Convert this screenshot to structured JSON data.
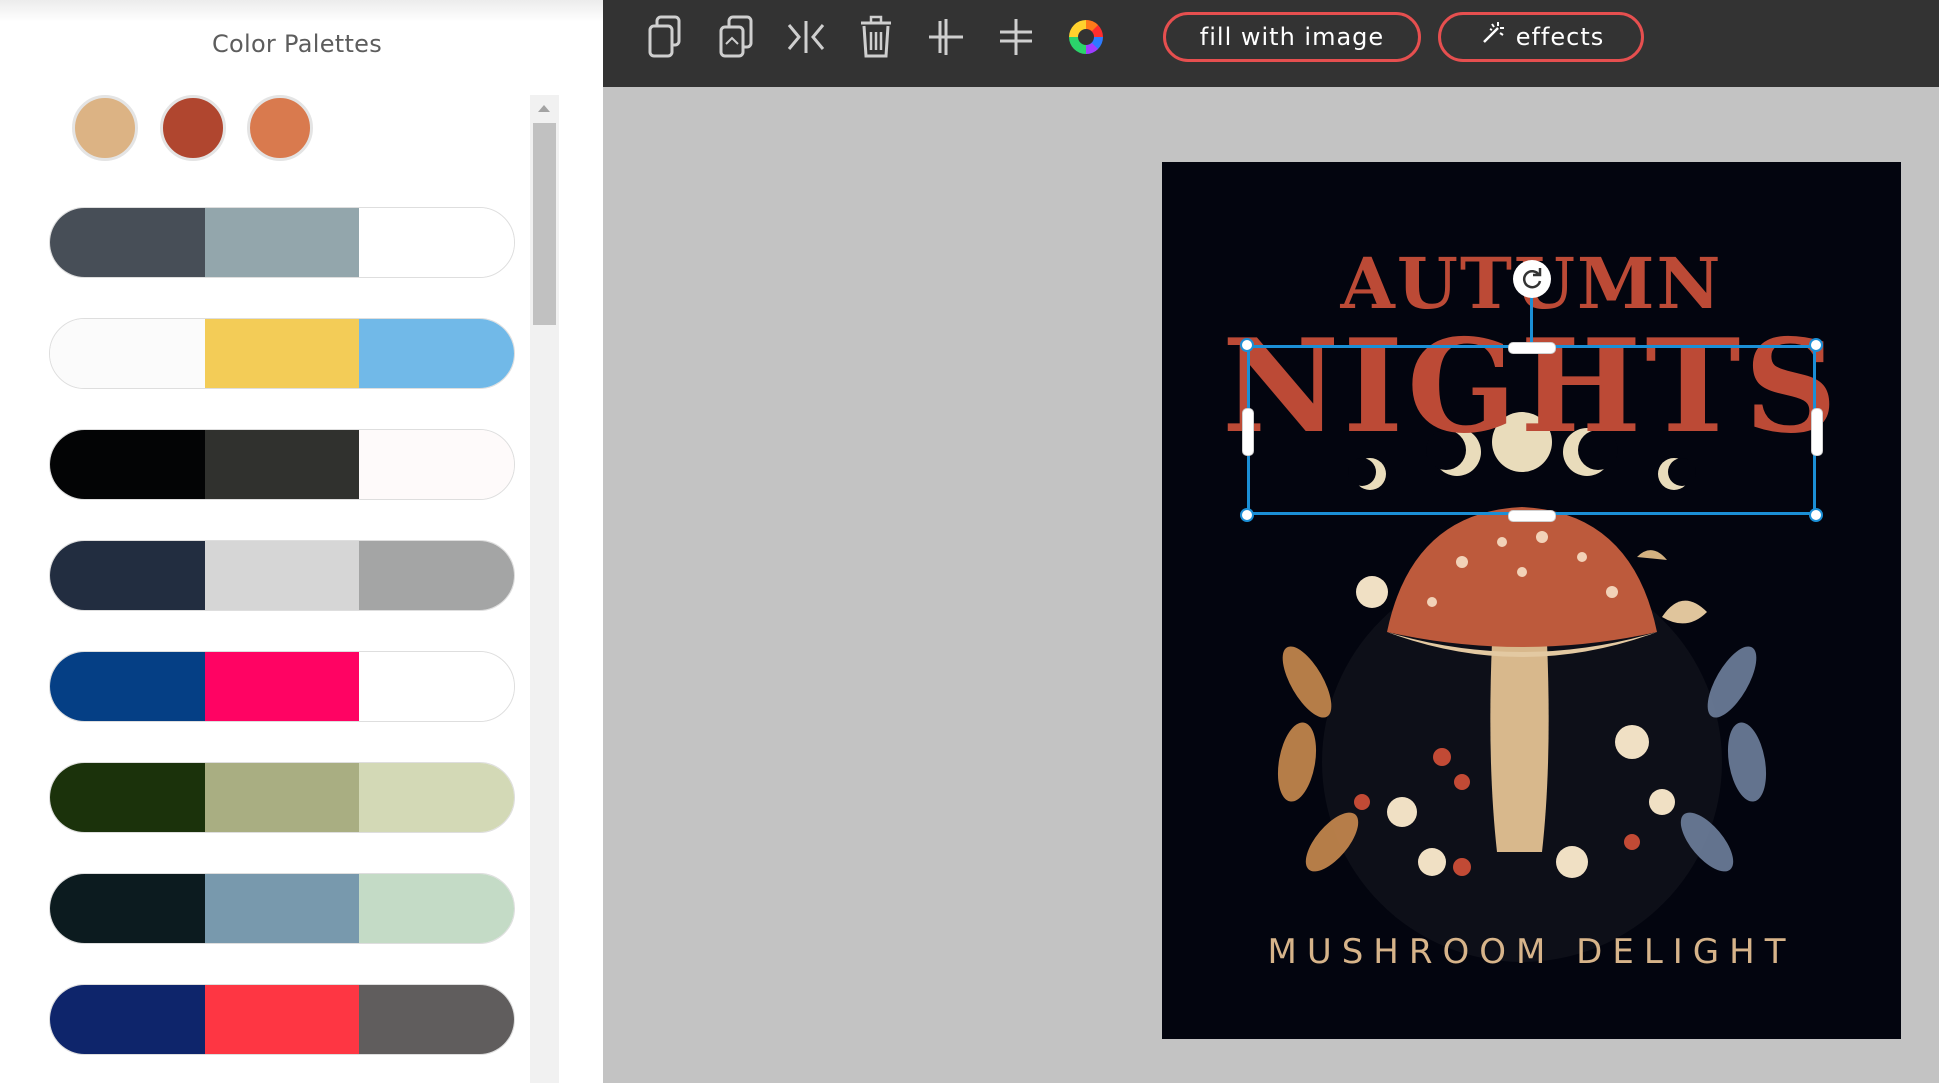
{
  "sidebar": {
    "title": "Color Palettes",
    "swatches": [
      {
        "color": "#dcb384"
      },
      {
        "color": "#b0462f"
      },
      {
        "color": "#d97a4e"
      }
    ],
    "palettes": [
      [
        "#474e57",
        "#93a6ac",
        "#ffffff"
      ],
      [
        "#fbfbfb",
        "#f3cc57",
        "#71b9e8"
      ],
      [
        "#030405",
        "#30312e",
        "#fefafa"
      ],
      [
        "#222d40",
        "#d6d6d6",
        "#a4a5a5"
      ],
      [
        "#053f85",
        "#ff0363",
        "#ffffff"
      ],
      [
        "#1b320b",
        "#a9ae82",
        "#d3d9b6"
      ],
      [
        "#0c1b1f",
        "#7899ad",
        "#c4dbc6"
      ],
      [
        "#0e256b",
        "#fe3643",
        "#605d5d"
      ]
    ]
  },
  "toolbar": {
    "tools": [
      {
        "icon": "copy-icon",
        "label": "copy"
      },
      {
        "icon": "paste-icon",
        "label": "paste"
      },
      {
        "icon": "flip-icon",
        "label": "flip"
      },
      {
        "icon": "trash-icon",
        "label": "delete"
      },
      {
        "icon": "align-center-icon",
        "label": "align center"
      },
      {
        "icon": "align-middle-icon",
        "label": "align middle"
      },
      {
        "icon": "color-wheel-icon",
        "label": "color"
      }
    ],
    "fill_label": "fill with image",
    "effects_label": "effects",
    "accent": "#e64f4f"
  },
  "artwork": {
    "line1": "AUTUMN",
    "line2": "NIGHTS",
    "line3": "MUSHROOM DELIGHT",
    "background": "#03050f",
    "title_color": "#bc4a36"
  },
  "selection": {
    "color": "#1b8fd6"
  }
}
